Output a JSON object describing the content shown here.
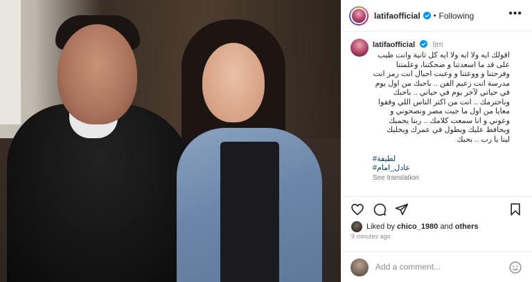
{
  "header": {
    "username": "latifaofficial",
    "separator": "•",
    "follow_status": "Following",
    "more": "•••"
  },
  "caption": {
    "username": "latifaofficial",
    "time": "9m",
    "lines": [
      "اقولك ايه ولا ايه ولا ايه كل ثانية وانت طيب",
      "على قد ما اسعدتنا و ضحكتنا، وعلمتنا",
      "وفرحتنا و ووعتنا و وعبت اجيال انت رمز انت",
      "مدرسة انت زعيم الفن .. باحبك من اول يوم",
      "في حياتي لآخر يوم في حياتي .. باحبك",
      "وباحترمك .. انت من اكتر الناس اللي وقفوا",
      "معايا من اول ما جيت مصر ونصحوني و",
      "وعوني و انا سمعت كلامك .. ربنا يحميك",
      "ويحافظ عليك ويطول في عمرك ويخليك",
      "لينا يا رب .. بحبك"
    ],
    "hashtags": [
      "#لطيفة",
      "#عادل_امام"
    ],
    "see_translation": "See translation"
  },
  "likes": {
    "prefix": "Liked by",
    "user": "chico_1980",
    "and": "and",
    "others": "others"
  },
  "timestamp": "9 minutes ago",
  "comment_input": {
    "placeholder": "Add a comment..."
  }
}
